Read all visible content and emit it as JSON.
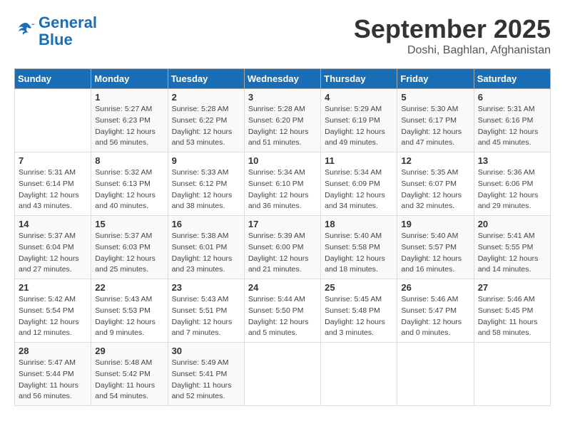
{
  "header": {
    "logo_line1": "General",
    "logo_line2": "Blue",
    "month": "September 2025",
    "location": "Doshi, Baghlan, Afghanistan"
  },
  "weekdays": [
    "Sunday",
    "Monday",
    "Tuesday",
    "Wednesday",
    "Thursday",
    "Friday",
    "Saturday"
  ],
  "weeks": [
    [
      {
        "day": "",
        "info": ""
      },
      {
        "day": "1",
        "info": "Sunrise: 5:27 AM\nSunset: 6:23 PM\nDaylight: 12 hours\nand 56 minutes."
      },
      {
        "day": "2",
        "info": "Sunrise: 5:28 AM\nSunset: 6:22 PM\nDaylight: 12 hours\nand 53 minutes."
      },
      {
        "day": "3",
        "info": "Sunrise: 5:28 AM\nSunset: 6:20 PM\nDaylight: 12 hours\nand 51 minutes."
      },
      {
        "day": "4",
        "info": "Sunrise: 5:29 AM\nSunset: 6:19 PM\nDaylight: 12 hours\nand 49 minutes."
      },
      {
        "day": "5",
        "info": "Sunrise: 5:30 AM\nSunset: 6:17 PM\nDaylight: 12 hours\nand 47 minutes."
      },
      {
        "day": "6",
        "info": "Sunrise: 5:31 AM\nSunset: 6:16 PM\nDaylight: 12 hours\nand 45 minutes."
      }
    ],
    [
      {
        "day": "7",
        "info": "Sunrise: 5:31 AM\nSunset: 6:14 PM\nDaylight: 12 hours\nand 43 minutes."
      },
      {
        "day": "8",
        "info": "Sunrise: 5:32 AM\nSunset: 6:13 PM\nDaylight: 12 hours\nand 40 minutes."
      },
      {
        "day": "9",
        "info": "Sunrise: 5:33 AM\nSunset: 6:12 PM\nDaylight: 12 hours\nand 38 minutes."
      },
      {
        "day": "10",
        "info": "Sunrise: 5:34 AM\nSunset: 6:10 PM\nDaylight: 12 hours\nand 36 minutes."
      },
      {
        "day": "11",
        "info": "Sunrise: 5:34 AM\nSunset: 6:09 PM\nDaylight: 12 hours\nand 34 minutes."
      },
      {
        "day": "12",
        "info": "Sunrise: 5:35 AM\nSunset: 6:07 PM\nDaylight: 12 hours\nand 32 minutes."
      },
      {
        "day": "13",
        "info": "Sunrise: 5:36 AM\nSunset: 6:06 PM\nDaylight: 12 hours\nand 29 minutes."
      }
    ],
    [
      {
        "day": "14",
        "info": "Sunrise: 5:37 AM\nSunset: 6:04 PM\nDaylight: 12 hours\nand 27 minutes."
      },
      {
        "day": "15",
        "info": "Sunrise: 5:37 AM\nSunset: 6:03 PM\nDaylight: 12 hours\nand 25 minutes."
      },
      {
        "day": "16",
        "info": "Sunrise: 5:38 AM\nSunset: 6:01 PM\nDaylight: 12 hours\nand 23 minutes."
      },
      {
        "day": "17",
        "info": "Sunrise: 5:39 AM\nSunset: 6:00 PM\nDaylight: 12 hours\nand 21 minutes."
      },
      {
        "day": "18",
        "info": "Sunrise: 5:40 AM\nSunset: 5:58 PM\nDaylight: 12 hours\nand 18 minutes."
      },
      {
        "day": "19",
        "info": "Sunrise: 5:40 AM\nSunset: 5:57 PM\nDaylight: 12 hours\nand 16 minutes."
      },
      {
        "day": "20",
        "info": "Sunrise: 5:41 AM\nSunset: 5:55 PM\nDaylight: 12 hours\nand 14 minutes."
      }
    ],
    [
      {
        "day": "21",
        "info": "Sunrise: 5:42 AM\nSunset: 5:54 PM\nDaylight: 12 hours\nand 12 minutes."
      },
      {
        "day": "22",
        "info": "Sunrise: 5:43 AM\nSunset: 5:53 PM\nDaylight: 12 hours\nand 9 minutes."
      },
      {
        "day": "23",
        "info": "Sunrise: 5:43 AM\nSunset: 5:51 PM\nDaylight: 12 hours\nand 7 minutes."
      },
      {
        "day": "24",
        "info": "Sunrise: 5:44 AM\nSunset: 5:50 PM\nDaylight: 12 hours\nand 5 minutes."
      },
      {
        "day": "25",
        "info": "Sunrise: 5:45 AM\nSunset: 5:48 PM\nDaylight: 12 hours\nand 3 minutes."
      },
      {
        "day": "26",
        "info": "Sunrise: 5:46 AM\nSunset: 5:47 PM\nDaylight: 12 hours\nand 0 minutes."
      },
      {
        "day": "27",
        "info": "Sunrise: 5:46 AM\nSunset: 5:45 PM\nDaylight: 11 hours\nand 58 minutes."
      }
    ],
    [
      {
        "day": "28",
        "info": "Sunrise: 5:47 AM\nSunset: 5:44 PM\nDaylight: 11 hours\nand 56 minutes."
      },
      {
        "day": "29",
        "info": "Sunrise: 5:48 AM\nSunset: 5:42 PM\nDaylight: 11 hours\nand 54 minutes."
      },
      {
        "day": "30",
        "info": "Sunrise: 5:49 AM\nSunset: 5:41 PM\nDaylight: 11 hours\nand 52 minutes."
      },
      {
        "day": "",
        "info": ""
      },
      {
        "day": "",
        "info": ""
      },
      {
        "day": "",
        "info": ""
      },
      {
        "day": "",
        "info": ""
      }
    ]
  ]
}
